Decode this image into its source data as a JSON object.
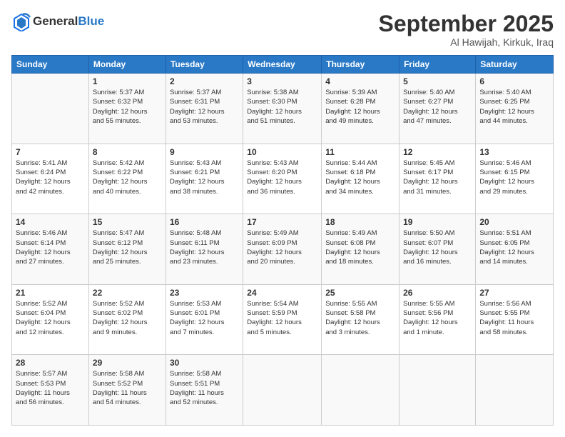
{
  "header": {
    "logo_line1": "General",
    "logo_line2": "Blue",
    "month": "September 2025",
    "location": "Al Hawijah, Kirkuk, Iraq"
  },
  "weekdays": [
    "Sunday",
    "Monday",
    "Tuesday",
    "Wednesday",
    "Thursday",
    "Friday",
    "Saturday"
  ],
  "weeks": [
    [
      {
        "day": "",
        "info": ""
      },
      {
        "day": "1",
        "info": "Sunrise: 5:37 AM\nSunset: 6:32 PM\nDaylight: 12 hours\nand 55 minutes."
      },
      {
        "day": "2",
        "info": "Sunrise: 5:37 AM\nSunset: 6:31 PM\nDaylight: 12 hours\nand 53 minutes."
      },
      {
        "day": "3",
        "info": "Sunrise: 5:38 AM\nSunset: 6:30 PM\nDaylight: 12 hours\nand 51 minutes."
      },
      {
        "day": "4",
        "info": "Sunrise: 5:39 AM\nSunset: 6:28 PM\nDaylight: 12 hours\nand 49 minutes."
      },
      {
        "day": "5",
        "info": "Sunrise: 5:40 AM\nSunset: 6:27 PM\nDaylight: 12 hours\nand 47 minutes."
      },
      {
        "day": "6",
        "info": "Sunrise: 5:40 AM\nSunset: 6:25 PM\nDaylight: 12 hours\nand 44 minutes."
      }
    ],
    [
      {
        "day": "7",
        "info": "Sunrise: 5:41 AM\nSunset: 6:24 PM\nDaylight: 12 hours\nand 42 minutes."
      },
      {
        "day": "8",
        "info": "Sunrise: 5:42 AM\nSunset: 6:22 PM\nDaylight: 12 hours\nand 40 minutes."
      },
      {
        "day": "9",
        "info": "Sunrise: 5:43 AM\nSunset: 6:21 PM\nDaylight: 12 hours\nand 38 minutes."
      },
      {
        "day": "10",
        "info": "Sunrise: 5:43 AM\nSunset: 6:20 PM\nDaylight: 12 hours\nand 36 minutes."
      },
      {
        "day": "11",
        "info": "Sunrise: 5:44 AM\nSunset: 6:18 PM\nDaylight: 12 hours\nand 34 minutes."
      },
      {
        "day": "12",
        "info": "Sunrise: 5:45 AM\nSunset: 6:17 PM\nDaylight: 12 hours\nand 31 minutes."
      },
      {
        "day": "13",
        "info": "Sunrise: 5:46 AM\nSunset: 6:15 PM\nDaylight: 12 hours\nand 29 minutes."
      }
    ],
    [
      {
        "day": "14",
        "info": "Sunrise: 5:46 AM\nSunset: 6:14 PM\nDaylight: 12 hours\nand 27 minutes."
      },
      {
        "day": "15",
        "info": "Sunrise: 5:47 AM\nSunset: 6:12 PM\nDaylight: 12 hours\nand 25 minutes."
      },
      {
        "day": "16",
        "info": "Sunrise: 5:48 AM\nSunset: 6:11 PM\nDaylight: 12 hours\nand 23 minutes."
      },
      {
        "day": "17",
        "info": "Sunrise: 5:49 AM\nSunset: 6:09 PM\nDaylight: 12 hours\nand 20 minutes."
      },
      {
        "day": "18",
        "info": "Sunrise: 5:49 AM\nSunset: 6:08 PM\nDaylight: 12 hours\nand 18 minutes."
      },
      {
        "day": "19",
        "info": "Sunrise: 5:50 AM\nSunset: 6:07 PM\nDaylight: 12 hours\nand 16 minutes."
      },
      {
        "day": "20",
        "info": "Sunrise: 5:51 AM\nSunset: 6:05 PM\nDaylight: 12 hours\nand 14 minutes."
      }
    ],
    [
      {
        "day": "21",
        "info": "Sunrise: 5:52 AM\nSunset: 6:04 PM\nDaylight: 12 hours\nand 12 minutes."
      },
      {
        "day": "22",
        "info": "Sunrise: 5:52 AM\nSunset: 6:02 PM\nDaylight: 12 hours\nand 9 minutes."
      },
      {
        "day": "23",
        "info": "Sunrise: 5:53 AM\nSunset: 6:01 PM\nDaylight: 12 hours\nand 7 minutes."
      },
      {
        "day": "24",
        "info": "Sunrise: 5:54 AM\nSunset: 5:59 PM\nDaylight: 12 hours\nand 5 minutes."
      },
      {
        "day": "25",
        "info": "Sunrise: 5:55 AM\nSunset: 5:58 PM\nDaylight: 12 hours\nand 3 minutes."
      },
      {
        "day": "26",
        "info": "Sunrise: 5:55 AM\nSunset: 5:56 PM\nDaylight: 12 hours\nand 1 minute."
      },
      {
        "day": "27",
        "info": "Sunrise: 5:56 AM\nSunset: 5:55 PM\nDaylight: 11 hours\nand 58 minutes."
      }
    ],
    [
      {
        "day": "28",
        "info": "Sunrise: 5:57 AM\nSunset: 5:53 PM\nDaylight: 11 hours\nand 56 minutes."
      },
      {
        "day": "29",
        "info": "Sunrise: 5:58 AM\nSunset: 5:52 PM\nDaylight: 11 hours\nand 54 minutes."
      },
      {
        "day": "30",
        "info": "Sunrise: 5:58 AM\nSunset: 5:51 PM\nDaylight: 11 hours\nand 52 minutes."
      },
      {
        "day": "",
        "info": ""
      },
      {
        "day": "",
        "info": ""
      },
      {
        "day": "",
        "info": ""
      },
      {
        "day": "",
        "info": ""
      }
    ]
  ]
}
